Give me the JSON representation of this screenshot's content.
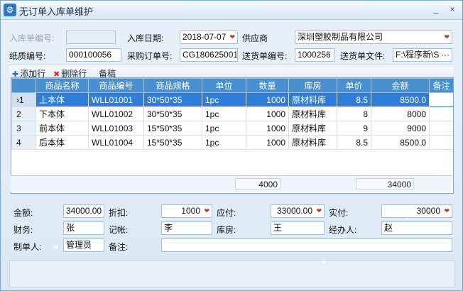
{
  "window": {
    "title": "无订单入库单维护",
    "min_label": "_",
    "close_label": "×"
  },
  "form": {
    "receipt_no_label": "入库单编号:",
    "receipt_no_value": "",
    "date_label": "入库日期:",
    "date_value": "2018-07-07",
    "supplier_label": "供应商",
    "supplier_value": "深圳塑胶制品有限公司",
    "paper_no_label": "纸质编号:",
    "paper_no_value": "000100056",
    "po_label": "采购订单号:",
    "po_value": "CG180625001",
    "delivery_no_label": "送货单编号:",
    "delivery_no_value": "1000256",
    "delivery_file_label": "送货单文件:",
    "delivery_file_value": "F:\\程序新\\S",
    "delivery_file_more": "···"
  },
  "toolbar": {
    "add_label": "添加行",
    "delete_label": "删除行",
    "template_label": "备稿"
  },
  "grid": {
    "columns": [
      "商品名称",
      "商品编号",
      "商品规格",
      "单位",
      "数量",
      "库房",
      "单价",
      "金额",
      "备注"
    ],
    "rows": [
      {
        "idx": "1",
        "name": "上本体",
        "code": "WLL01001",
        "spec": "30*50*35",
        "unit": "1pc",
        "qty": "1000",
        "store": "原材料库",
        "price": "8.5",
        "amount": "8500.0",
        "note": ""
      },
      {
        "idx": "2",
        "name": "下本体",
        "code": "WLL01002",
        "spec": "30*50*35",
        "unit": "1pc",
        "qty": "1000",
        "store": "原材料库",
        "price": "8",
        "amount": "8000",
        "note": ""
      },
      {
        "idx": "3",
        "name": "前本体",
        "code": "WLL01003",
        "spec": "15*50*35",
        "unit": "1pc",
        "qty": "1000",
        "store": "原材料库",
        "price": "9",
        "amount": "9000",
        "note": ""
      },
      {
        "idx": "4",
        "name": "后本体",
        "code": "WLL01004",
        "spec": "15*50*35",
        "unit": "1pc",
        "qty": "1000",
        "store": "原材料库",
        "price": "8.5",
        "amount": "8500.0",
        "note": ""
      }
    ],
    "total_qty": "4000",
    "total_amount": "34000"
  },
  "totals": {
    "amount_label": "金额:",
    "amount_value": "34000.00",
    "discount_label": "折扣:",
    "discount_value": "1000",
    "payable_label": "应付:",
    "payable_value": "33000.00",
    "paid_label": "实付:",
    "paid_value": "30000",
    "finance_label": "财务:",
    "finance_value": "张",
    "bookkeeper_label": "记帐:",
    "bookkeeper_value": "李",
    "warehouse_label": "库房:",
    "warehouse_value": "王",
    "handler_label": "经办人:",
    "handler_value": "赵",
    "creator_label": "制单人:",
    "creator_value": "管理员",
    "remark_label": "备注:",
    "remark_value": ""
  },
  "colors": {
    "header_blue": "#4a8fd0",
    "selection_blue": "#2f7dd8",
    "dropdown_arrow": "#c0392b"
  },
  "icons": {
    "app": "settings-app-icon",
    "add": "plus-icon",
    "delete": "x-icon",
    "dropdown": "chevron-down-icon"
  }
}
